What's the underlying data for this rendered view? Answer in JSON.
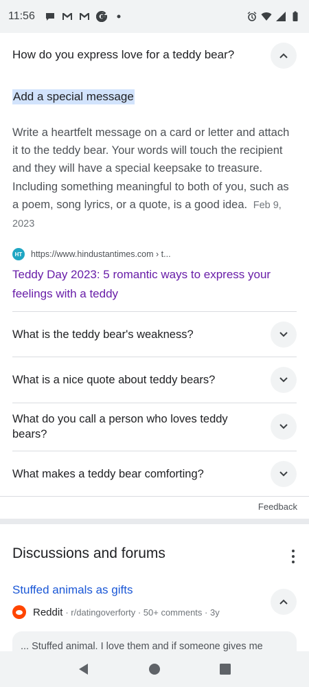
{
  "status_bar": {
    "time": "11:56",
    "left_icons": [
      "chat-bubble-icon",
      "gmail-icon",
      "gmail-icon",
      "google-icon",
      "dot-icon"
    ],
    "right_icons": [
      "alarm-icon",
      "wifi-icon",
      "signal-icon",
      "battery-icon"
    ]
  },
  "expanded_faq": {
    "question": "How do you express love for a teddy bear?",
    "answer_heading": "Add a special message",
    "answer_text": "Write a heartfelt message on a card or letter and attach it to the teddy bear. Your words will touch the recipient and they will have a special keepsake to treasure. Including something meaningful to both of you, such as a poem, song lyrics, or a quote, is a good idea.",
    "date": "Feb 9, 2023",
    "source_url": "https://www.hindustantimes.com › t...",
    "favicon_text": "HT",
    "source_title": "Teddy Day 2023: 5 romantic ways to express your feelings with a teddy"
  },
  "faq_items": [
    {
      "question": "What is the teddy bear's weakness?"
    },
    {
      "question": "What is a nice quote about teddy bears?"
    },
    {
      "question": "What do you call a person who loves teddy bears?"
    },
    {
      "question": "What makes a teddy bear comforting?"
    }
  ],
  "feedback_label": "Feedback",
  "discussions": {
    "title": "Discussions and forums",
    "result_title": "Stuffed animals as gifts",
    "source": "Reddit",
    "meta": "· r/datingoverforty · 50+ comments · 3y",
    "snippet": "... Stuffed animal. I love them and if someone gives me"
  },
  "colors": {
    "link_visited": "#681da8",
    "link": "#1a57d6",
    "highlight": "#d2e3fc",
    "reddit": "#ff4500"
  }
}
